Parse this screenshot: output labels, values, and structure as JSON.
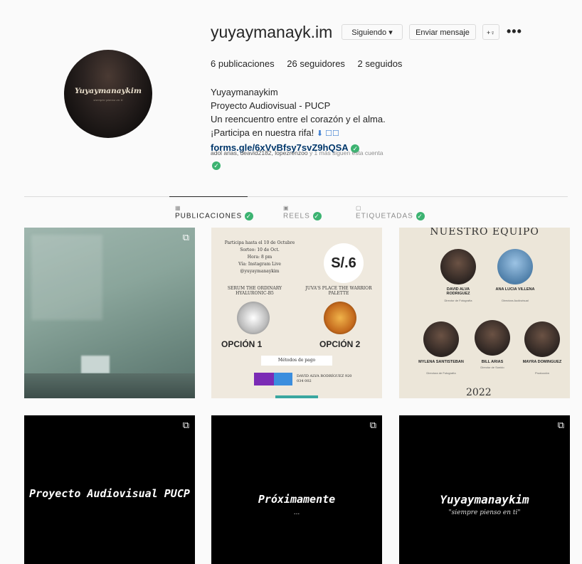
{
  "profile": {
    "username": "yuyaymanayk.im",
    "following_btn": "Siguiendo ▾",
    "message_btn": "Enviar mensaje",
    "add_user_icon": "+♀",
    "more_icon": "•••",
    "avatar_name": "Yuyaymanaykim",
    "avatar_sub": "siempre pienso en ti"
  },
  "stats": {
    "posts": "6 publicaciones",
    "followers": "26 seguidores",
    "following": "2 seguidos"
  },
  "bio": {
    "name": "Yuyaymanaykim",
    "line1": "Proyecto Audiovisual - PUCP",
    "line2": "Un reencuentro entre el corazón y el alma.",
    "line3": "¡Participa en nuestra rifa!",
    "line3_extra": "⬇ ☐☐",
    "link": "forms.gle/6xVvBfsy7svZ9hQSA",
    "mutual_names": "adol arias, deavid2182, lopezrenzoo",
    "mutual_rest": " y 1 más siguen esta cuenta"
  },
  "tabs": [
    {
      "label": "PUBLICACIONES",
      "icon": "grid-icon"
    },
    {
      "label": "REELS",
      "icon": "reels-icon"
    },
    {
      "label": "ETIQUETADAS",
      "icon": "tagged-icon"
    }
  ],
  "posts": {
    "rifa": {
      "header1": "Participa hasta el 10 de Octubre",
      "header2": "Sorteo: 10 de Oct.",
      "header3": "Hora: 8 pm",
      "header4": "Vía: Instagram Live",
      "header5": "@yuyaymanaykim",
      "price": "S/.6",
      "opt1_name": "SERUM THE ORDINARY HYALURONIC-B5",
      "opt2_name": "JUVA'S PLACE THE WARRIOR PALETTE",
      "opt1": "OPCIÓN 1",
      "opt2": "OPCIÓN 2",
      "pay": "Métodos de pago",
      "contact": "DAVID ALVA RODRÍGUEZ 920 034 002"
    },
    "team": {
      "title": "NUESTRO EQUIPO",
      "members": [
        {
          "name": "DAVID ALVA RODRIGUEZ",
          "role": "Director de Fotografía"
        },
        {
          "name": "ANA LUCIA VILLENA",
          "role": "Directora Audiovisual"
        },
        {
          "name": "MYLENA SANTISTEBAN",
          "role": "Directora de Fotografía"
        },
        {
          "name": "BILL ARIAS",
          "role": "Director de Sonido"
        },
        {
          "name": "MAYRA DOMINGUEZ",
          "role": "Producción"
        }
      ],
      "year": "2022"
    },
    "reel1": {
      "title": "Proyecto Audiovisual PUCP"
    },
    "reel2": {
      "title": "Próximamente",
      "sub": "..."
    },
    "reel3": {
      "title": "Yuyaymanaykim",
      "sub": "\"siempre pienso en ti\""
    }
  },
  "colors": {
    "link": "#00376b",
    "verified_green": "#3cb371",
    "border": "#dbdbdb"
  }
}
